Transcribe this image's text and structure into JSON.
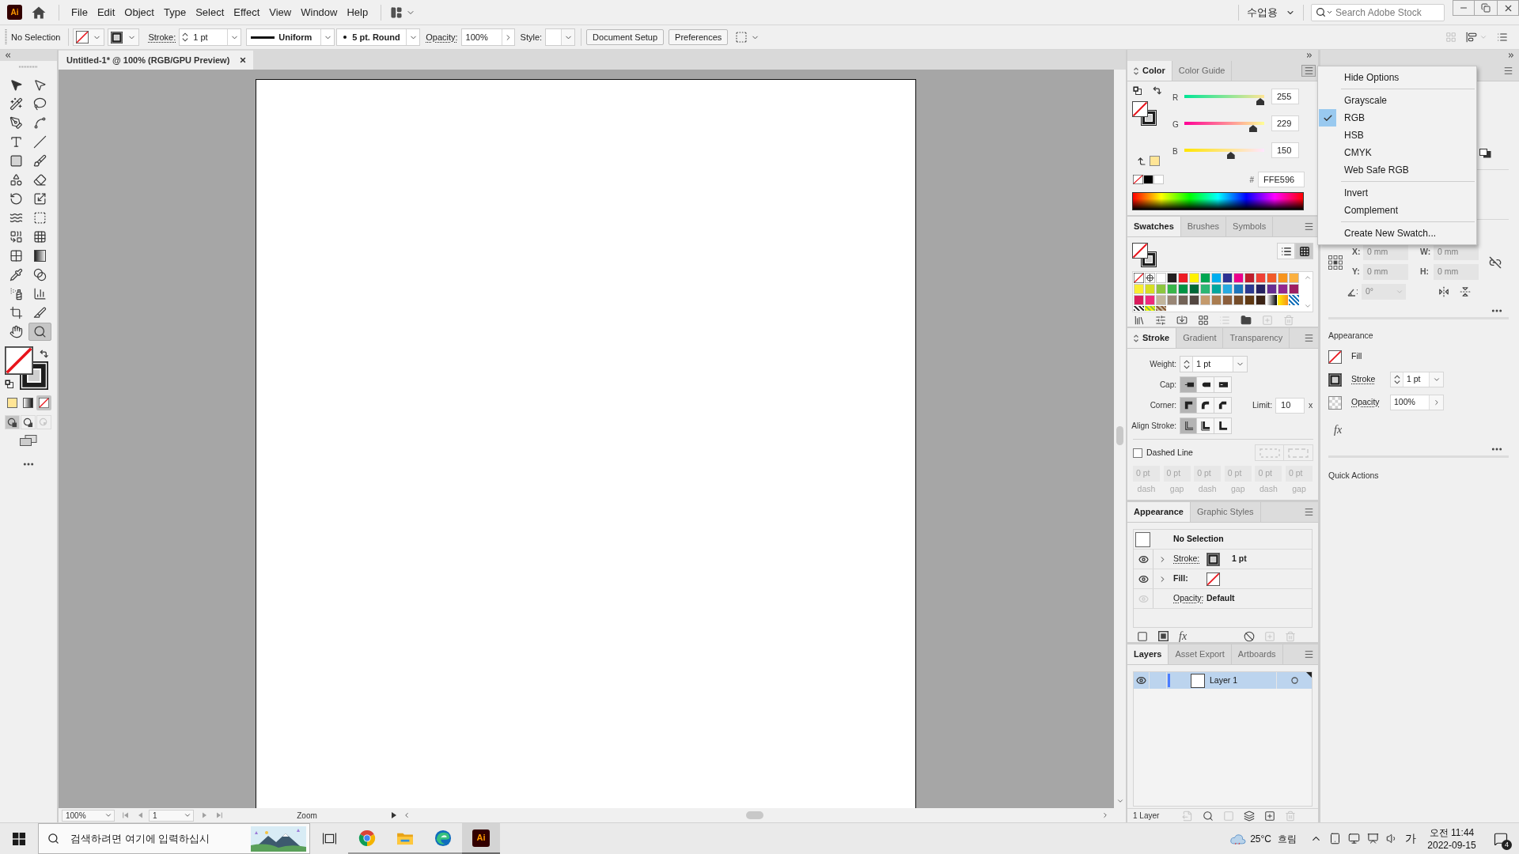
{
  "app_bar": {
    "logo": "Ai",
    "menu": [
      "File",
      "Edit",
      "Object",
      "Type",
      "Select",
      "Effect",
      "View",
      "Window",
      "Help"
    ],
    "workspace": "수업용",
    "search": {
      "placeholder": "Search Adobe Stock"
    }
  },
  "control_bar": {
    "selection": "No Selection",
    "stroke_label": "Stroke:",
    "stroke_weight": "1 pt",
    "profile": "Uniform",
    "brush": "5 pt. Round",
    "opacity_label": "Opacity:",
    "opacity": "100%",
    "style_label": "Style:",
    "buttons": [
      "Document Setup",
      "Preferences"
    ],
    "right_tools": [
      {
        "kind": "arrange",
        "disabled": true
      },
      {
        "kind": "align",
        "disabled": false
      },
      {
        "kind": "list",
        "disabled": false
      }
    ]
  },
  "tools": [
    {
      "kind": "selection",
      "selected": false
    },
    {
      "kind": "direct_selection",
      "selected": false
    },
    {
      "kind": "magic_wand",
      "selected": false
    },
    {
      "kind": "lasso",
      "selected": false
    },
    {
      "kind": "pen",
      "selected": false
    },
    {
      "kind": "curvature",
      "selected": false
    },
    {
      "kind": "type",
      "selected": false
    },
    {
      "kind": "line",
      "selected": false
    },
    {
      "kind": "rectangle",
      "selected": false
    },
    {
      "kind": "paintbrush",
      "selected": false
    },
    {
      "kind": "shaper",
      "selected": false
    },
    {
      "kind": "eraser",
      "selected": false
    },
    {
      "kind": "rotate",
      "selected": false
    },
    {
      "kind": "scale",
      "selected": false
    },
    {
      "kind": "warp",
      "selected": false
    },
    {
      "kind": "free_transform",
      "selected": false
    },
    {
      "kind": "shape_builder",
      "selected": false
    },
    {
      "kind": "perspective_grid",
      "selected": false
    },
    {
      "kind": "mesh",
      "selected": false
    },
    {
      "kind": "gradient",
      "selected": false
    },
    {
      "kind": "eyedropper",
      "selected": false
    },
    {
      "kind": "blend",
      "selected": false
    },
    {
      "kind": "symbol_sprayer",
      "selected": false
    },
    {
      "kind": "column_graph",
      "selected": false
    },
    {
      "kind": "artboard",
      "selected": false
    },
    {
      "kind": "slice",
      "selected": false
    },
    {
      "kind": "hand",
      "selected": false
    },
    {
      "kind": "zoom",
      "selected": true
    }
  ],
  "color_modes": [
    {
      "kind": "color",
      "selected": false
    },
    {
      "kind": "gradient",
      "selected": false
    },
    {
      "kind": "none",
      "selected": true
    }
  ],
  "draw_modes": [
    {
      "kind": "normal",
      "selected": true,
      "disabled": false
    },
    {
      "kind": "behind",
      "selected": false,
      "disabled": false
    },
    {
      "kind": "inside",
      "selected": false,
      "disabled": true
    }
  ],
  "document": {
    "title": "Untitled-1* @ 100% (RGB/GPU Preview)"
  },
  "status_bar": {
    "zoom": "100%",
    "artboard": "1",
    "info": "Zoom"
  },
  "color_panel": {
    "tabs": [
      {
        "label": "Color",
        "selected": true
      },
      {
        "label": "Color Guide",
        "selected": false
      }
    ],
    "menu_open": true,
    "channels": [
      {
        "name": "R",
        "value": "255",
        "level": 1
      },
      {
        "name": "G",
        "value": "229",
        "level": 0.9
      },
      {
        "name": "B",
        "value": "150",
        "level": 0.59
      }
    ],
    "quick_swatches": [
      {
        "kind": "none"
      },
      {
        "kind": "color",
        "color": "#000000"
      },
      {
        "kind": "color",
        "color": "#ffffff"
      }
    ],
    "hex_label": "#",
    "hex": "FFE596"
  },
  "color_menu": {
    "groups": [
      {
        "items": [
          {
            "label": "Hide Options",
            "checked": false
          }
        ]
      },
      {
        "items": [
          {
            "label": "Grayscale",
            "checked": false
          },
          {
            "label": "RGB",
            "checked": true
          },
          {
            "label": "HSB",
            "checked": false
          },
          {
            "label": "CMYK",
            "checked": false
          },
          {
            "label": "Web Safe RGB",
            "checked": false
          }
        ]
      },
      {
        "items": [
          {
            "label": "Invert",
            "checked": false
          },
          {
            "label": "Complement",
            "checked": false
          }
        ]
      },
      {
        "items": [
          {
            "label": "Create New Swatch...",
            "checked": false
          }
        ]
      }
    ]
  },
  "swatches_panel": {
    "tabs": [
      {
        "label": "Swatches",
        "selected": true
      },
      {
        "label": "Brushes",
        "selected": false
      },
      {
        "label": "Symbols",
        "selected": false
      }
    ],
    "views": [
      {
        "kind": "list",
        "selected": false
      },
      {
        "kind": "grid",
        "selected": true
      }
    ],
    "swatches": [
      {
        "kind": "none"
      },
      {
        "kind": "registration"
      },
      {
        "kind": "color",
        "color": "#ffffff"
      },
      {
        "kind": "color",
        "color": "#231f20"
      },
      {
        "kind": "color",
        "color": "#ed1c24"
      },
      {
        "kind": "color",
        "color": "#fff200"
      },
      {
        "kind": "color",
        "color": "#00a651"
      },
      {
        "kind": "color",
        "color": "#00aeef"
      },
      {
        "kind": "color",
        "color": "#2e3192"
      },
      {
        "kind": "color",
        "color": "#ec008c"
      },
      {
        "kind": "color",
        "color": "#be1e2d"
      },
      {
        "kind": "color",
        "color": "#ef4136"
      },
      {
        "kind": "color",
        "color": "#f15a29"
      },
      {
        "kind": "color",
        "color": "#f7941d"
      },
      {
        "kind": "color",
        "color": "#fbb040"
      },
      {
        "kind": "color",
        "color": "#f9ed32"
      },
      {
        "kind": "color",
        "color": "#d7df23"
      },
      {
        "kind": "color",
        "color": "#8dc63f"
      },
      {
        "kind": "color",
        "color": "#39b54a"
      },
      {
        "kind": "color",
        "color": "#009444"
      },
      {
        "kind": "color",
        "color": "#006838"
      },
      {
        "kind": "color",
        "color": "#2bb673"
      },
      {
        "kind": "color",
        "color": "#00a79d"
      },
      {
        "kind": "color",
        "color": "#27aae1"
      },
      {
        "kind": "color",
        "color": "#1c75bc"
      },
      {
        "kind": "color",
        "color": "#2b3990"
      },
      {
        "kind": "color",
        "color": "#262262"
      },
      {
        "kind": "color",
        "color": "#662d91"
      },
      {
        "kind": "color",
        "color": "#92278f"
      },
      {
        "kind": "color",
        "color": "#9e1f63"
      },
      {
        "kind": "color",
        "color": "#da1c5c"
      },
      {
        "kind": "color",
        "color": "#ee2a7b"
      },
      {
        "kind": "color",
        "color": "#c2b59b"
      },
      {
        "kind": "color",
        "color": "#998675"
      },
      {
        "kind": "color",
        "color": "#736357"
      },
      {
        "kind": "color",
        "color": "#534741"
      },
      {
        "kind": "color",
        "color": "#c49a6c"
      },
      {
        "kind": "color",
        "color": "#a97c50"
      },
      {
        "kind": "color",
        "color": "#8b5e3c"
      },
      {
        "kind": "color",
        "color": "#754c29"
      },
      {
        "kind": "color",
        "color": "#603913"
      },
      {
        "kind": "color",
        "color": "#3c2415"
      },
      {
        "kind": "gradient_gray"
      },
      {
        "kind": "gradient_warm"
      },
      {
        "kind": "pattern_blue"
      },
      {
        "kind": "pattern_dark"
      },
      {
        "kind": "pattern_leaf"
      },
      {
        "kind": "pattern_bark"
      }
    ],
    "footer": [
      {
        "kind": "library",
        "disabled": false
      },
      {
        "kind": "kinds",
        "disabled": false
      },
      {
        "kind": "import",
        "disabled": false
      },
      {
        "kind": "group_grid",
        "disabled": false
      },
      {
        "kind": "options",
        "disabled": true
      },
      {
        "kind": "folder",
        "disabled": false
      },
      {
        "kind": "new",
        "disabled": true
      },
      {
        "kind": "delete",
        "disabled": true
      }
    ]
  },
  "stroke_panel": {
    "tabs": [
      {
        "label": "Stroke",
        "selected": true
      },
      {
        "label": "Gradient",
        "selected": false
      },
      {
        "label": "Transparency",
        "selected": false
      }
    ],
    "weight_label": "Weight:",
    "weight": "1 pt",
    "cap_label": "Cap:",
    "caps": [
      {
        "kind": "butt",
        "selected": true
      },
      {
        "kind": "round",
        "selected": false
      },
      {
        "kind": "projecting",
        "selected": false
      }
    ],
    "corner_label": "Corner:",
    "corners": [
      {
        "kind": "miter",
        "selected": true
      },
      {
        "kind": "round",
        "selected": false
      },
      {
        "kind": "bevel",
        "selected": false
      }
    ],
    "limit_label": "Limit:",
    "limit": "10",
    "limit_unit": "x",
    "align_label": "Align Stroke:",
    "aligns": [
      {
        "kind": "center",
        "selected": true
      },
      {
        "kind": "inside",
        "selected": false
      },
      {
        "kind": "outside",
        "selected": false
      }
    ],
    "dashed_line": {
      "label": "Dashed Line",
      "checked": false
    },
    "dash_fields": [
      {
        "value": "0 pt",
        "label": "dash"
      },
      {
        "value": "0 pt",
        "label": "gap"
      },
      {
        "value": "0 pt",
        "label": "dash"
      },
      {
        "value": "0 pt",
        "label": "gap"
      },
      {
        "value": "0 pt",
        "label": "dash"
      },
      {
        "value": "0 pt",
        "label": "gap"
      }
    ]
  },
  "appearance_panel": {
    "tabs": [
      {
        "label": "Appearance",
        "selected": true
      },
      {
        "label": "Graphic Styles",
        "selected": false
      }
    ],
    "title": "No Selection",
    "rows": [
      {
        "kind": "stroke",
        "label": "Stroke:",
        "value": "1 pt",
        "dimmed": false
      },
      {
        "kind": "fill",
        "label": "Fill:",
        "dimmed": false
      },
      {
        "kind": "opacity",
        "label": "Opacity:",
        "value": "Default",
        "dimmed": true
      }
    ],
    "footer": [
      {
        "kind": "new_stroke",
        "disabled": false
      },
      {
        "kind": "new_fill",
        "disabled": false
      },
      {
        "kind": "effects",
        "label": "fx",
        "disabled": false
      },
      {
        "kind": "clear",
        "disabled": false
      },
      {
        "kind": "duplicate",
        "disabled": true
      },
      {
        "kind": "delete",
        "disabled": true
      }
    ]
  },
  "layers_panel": {
    "tabs": [
      {
        "label": "Layers",
        "selected": true
      },
      {
        "label": "Asset Export",
        "selected": false
      },
      {
        "label": "Artboards",
        "selected": false
      }
    ],
    "layers": [
      {
        "name": "Layer 1",
        "selected": true,
        "color": "#4a7cff"
      }
    ],
    "count": "1 Layer",
    "footer": [
      {
        "kind": "export",
        "disabled": true
      },
      {
        "kind": "locate",
        "disabled": false
      },
      {
        "kind": "clip",
        "disabled": true
      },
      {
        "kind": "sublayer",
        "disabled": false
      },
      {
        "kind": "new",
        "disabled": false
      },
      {
        "kind": "delete",
        "disabled": true
      }
    ]
  },
  "properties": {
    "transform": {
      "disabled": true,
      "x_label": "X:",
      "x": "0 mm",
      "w_label": "W:",
      "w": "0 mm",
      "y_label": "Y:",
      "y": "0 mm",
      "h_label": "H:",
      "h": "0 mm",
      "angle_label": ":",
      "angle": "0°"
    },
    "appearance": {
      "title": "Appearance",
      "fill_label": "Fill",
      "stroke_label": "Stroke",
      "stroke_weight": "1 pt",
      "opacity_label": "Opacity",
      "opacity": "100%",
      "fx_label": "fx"
    },
    "quick_actions": "Quick Actions"
  },
  "taskbar": {
    "search": {
      "placeholder": "검색하려면 여기에 입력하십시"
    },
    "apps": [
      {
        "kind": "round_browser",
        "selected": false
      },
      {
        "kind": "files",
        "selected": false
      },
      {
        "kind": "wave_browser",
        "selected": false
      },
      {
        "kind": "design_app",
        "selected": true,
        "label": "Ai"
      }
    ],
    "weather": {
      "temperature": "25°C",
      "condition": "흐림"
    },
    "ime": "가",
    "time": "오전 11:44",
    "date": "2022-09-15",
    "notifications": "4"
  }
}
